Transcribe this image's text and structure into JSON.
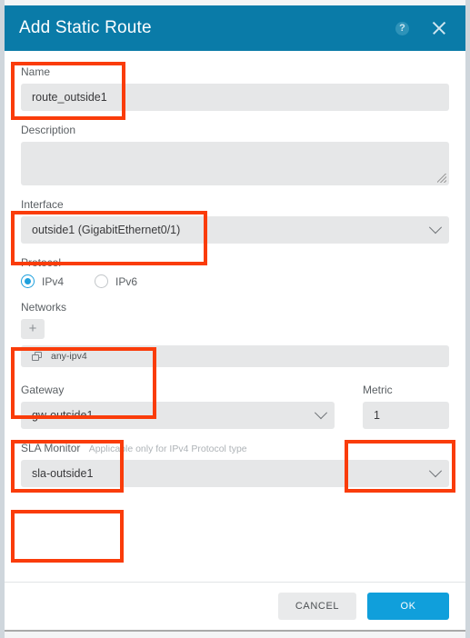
{
  "dialog": {
    "title": "Add Static Route",
    "help_icon": "help-icon",
    "close_icon": "close-icon"
  },
  "fields": {
    "name": {
      "label": "Name",
      "value": "route_outside1",
      "placeholder": ""
    },
    "description": {
      "label": "Description",
      "value": "",
      "placeholder": ""
    },
    "interface": {
      "label": "Interface",
      "value": "outside1 (GigabitEthernet0/1)"
    },
    "protocol": {
      "label": "Protocol",
      "options": [
        "IPv4",
        "IPv6"
      ],
      "selected": "IPv4"
    },
    "networks": {
      "label": "Networks",
      "add_label": "+",
      "items": [
        {
          "name": "any-ipv4",
          "icon": "network-group-icon"
        }
      ]
    },
    "gateway": {
      "label": "Gateway",
      "value": "gw-outside1"
    },
    "metric": {
      "label": "Metric",
      "value": "1",
      "placeholder": ""
    },
    "sla_monitor": {
      "label": "SLA Monitor",
      "hint": "Applicable only for IPv4 Protocol type",
      "value": "sla-outside1"
    }
  },
  "footer": {
    "cancel_label": "CANCEL",
    "ok_label": "OK"
  },
  "colors": {
    "titlebar": "#0a7ba8",
    "primary_button": "#109fdb",
    "accent_radio": "#1ea0dd",
    "annotation": "#fa3c0a",
    "field_background": "#e6e7e8"
  }
}
